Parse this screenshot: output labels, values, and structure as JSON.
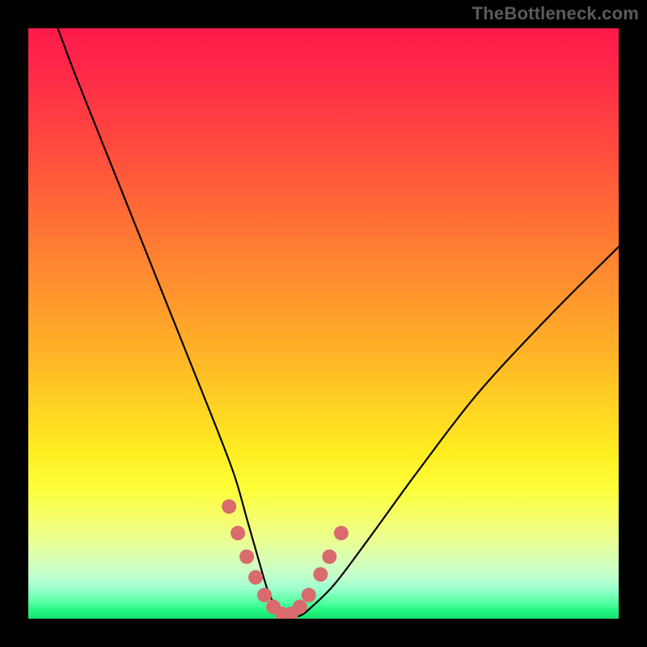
{
  "watermark": "TheBottleneck.com",
  "chart_data": {
    "type": "line",
    "title": "",
    "xlabel": "",
    "ylabel": "",
    "xlim": [
      0,
      100
    ],
    "ylim": [
      0,
      100
    ],
    "grid": false,
    "legend": false,
    "series": [
      {
        "name": "bottleneck-curve",
        "x": [
          5,
          8,
          12,
          16,
          20,
          24,
          28,
          32,
          35,
          37,
          39,
          40.5,
          42,
          44,
          46,
          48,
          52,
          58,
          66,
          76,
          88,
          100
        ],
        "y": [
          100,
          92,
          82,
          72,
          62,
          52,
          42,
          32,
          24,
          17,
          10,
          5,
          2,
          0.5,
          0.5,
          2,
          6,
          14,
          25,
          38,
          51,
          63
        ]
      }
    ],
    "markers": {
      "name": "highlight-dots",
      "color": "#d96b6e",
      "points_xy": [
        [
          34.0,
          19.0
        ],
        [
          35.5,
          14.5
        ],
        [
          37.0,
          10.5
        ],
        [
          38.5,
          7.0
        ],
        [
          40.0,
          4.0
        ],
        [
          41.5,
          2.0
        ],
        [
          43.0,
          0.8
        ],
        [
          44.5,
          0.8
        ],
        [
          46.0,
          2.0
        ],
        [
          47.5,
          4.0
        ],
        [
          49.5,
          7.5
        ],
        [
          51.0,
          10.5
        ],
        [
          53.0,
          14.5
        ]
      ]
    },
    "gradient_stops": [
      {
        "pos": 0.0,
        "color": "#ff1a4b"
      },
      {
        "pos": 0.32,
        "color": "#ff6e35"
      },
      {
        "pos": 0.64,
        "color": "#ffd223"
      },
      {
        "pos": 0.83,
        "color": "#f6ff6c"
      },
      {
        "pos": 0.95,
        "color": "#98ffcd"
      },
      {
        "pos": 1.0,
        "color": "#17e26e"
      }
    ]
  }
}
